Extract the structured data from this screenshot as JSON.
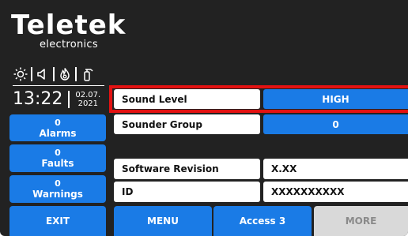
{
  "brand": {
    "name": "Teletek",
    "sub": "electronics"
  },
  "status_icons": [
    "sun-icon",
    "speaker-icon",
    "fire-icon",
    "extinguisher-icon"
  ],
  "clock": {
    "time": "13:22",
    "date_line1": "02.07.",
    "date_line2": "2021"
  },
  "sidebar": {
    "alarms": {
      "count": "0",
      "label": "Alarms"
    },
    "faults": {
      "count": "0",
      "label": "Faults"
    },
    "warnings": {
      "count": "0",
      "label": "Warnings"
    }
  },
  "settings": [
    {
      "label": "Sound Level",
      "value": "HIGH",
      "selected": true
    },
    {
      "label": "Sounder Group",
      "value": "0",
      "selected": false
    },
    {
      "label": "Software Revision",
      "value": "X.XX",
      "selected": false
    },
    {
      "label": "ID",
      "value": "XXXXXXXXXX",
      "selected": false
    }
  ],
  "bottom_bar": {
    "exit": "EXIT",
    "menu": "MENU",
    "access": "Access 3",
    "more": "MORE"
  },
  "colors": {
    "accent": "#1a7be6",
    "highlight": "#e31212",
    "background": "#222222"
  }
}
